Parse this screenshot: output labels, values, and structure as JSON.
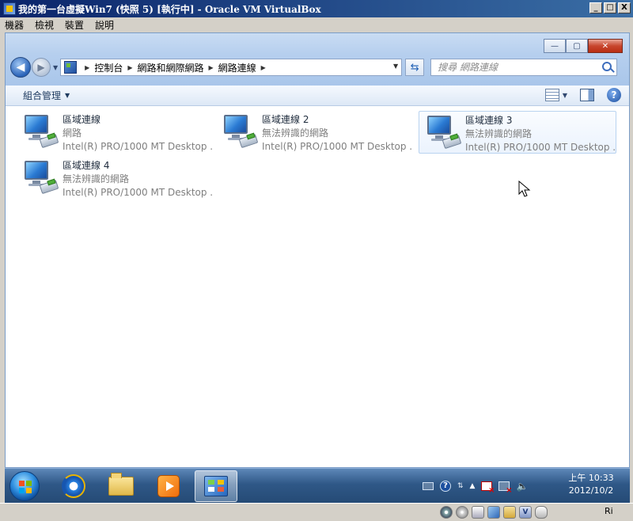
{
  "host": {
    "title": "我的第一台虛擬Win7 (快照 5) [執行中] - Oracle VM VirtualBox",
    "controls": {
      "minimize": "_",
      "maximize": "□",
      "close": "X"
    },
    "menu": [
      "機器",
      "檢視",
      "裝置",
      "說明"
    ],
    "status_right": "Ri"
  },
  "explorer": {
    "window_controls": {
      "minimize": "—",
      "maximize": "▢",
      "close": "✕"
    },
    "breadcrumb": [
      "控制台",
      "網路和網際網路",
      "網路連線"
    ],
    "search_placeholder": "搜尋 網路連線",
    "organize_label": "組合管理"
  },
  "connections": [
    {
      "name": "區域連線",
      "status": "網路",
      "device": "Intel(R) PRO/1000 MT Desktop ..."
    },
    {
      "name": "區域連線 2",
      "status": "無法辨識的網路",
      "device": "Intel(R) PRO/1000 MT Desktop ..."
    },
    {
      "name": "區域連線 3",
      "status": "無法辨識的網路",
      "device": "Intel(R) PRO/1000 MT Desktop ..."
    },
    {
      "name": "區域連線 4",
      "status": "無法辨識的網路",
      "device": "Intel(R) PRO/1000 MT Desktop ..."
    }
  ],
  "taskbar": {
    "clock_time": "上午 10:33",
    "clock_date": "2012/10/2"
  },
  "colors": {
    "accent": "#2a63b8",
    "hover_border": "#b9d3f0",
    "taskbar": "#2f5887"
  }
}
